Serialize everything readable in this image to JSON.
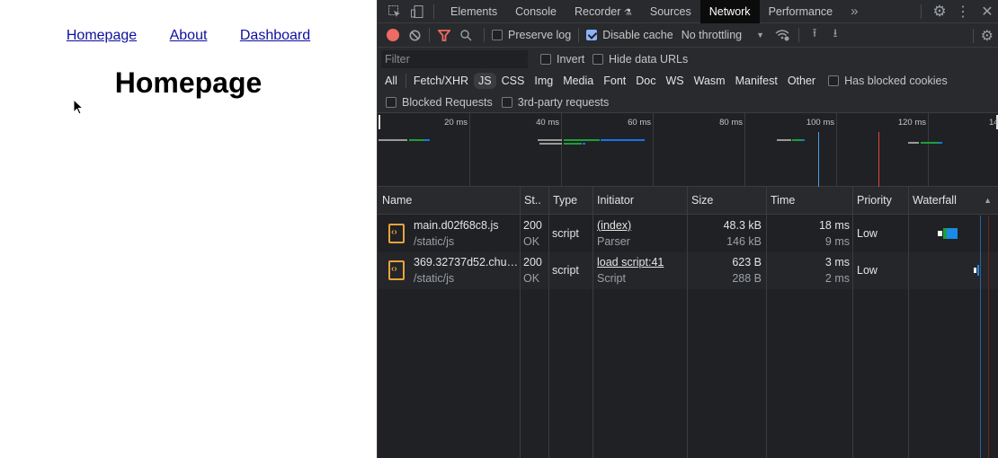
{
  "page": {
    "nav_links": [
      "Homepage",
      "About",
      "Dashboard"
    ],
    "heading": "Homepage"
  },
  "devtools": {
    "tabs": [
      "Elements",
      "Console",
      "Recorder",
      "Sources",
      "Network",
      "Performance"
    ],
    "active_tab": "Network",
    "more_tabs_icon": "»",
    "toolbar": {
      "preserve_log": "Preserve log",
      "preserve_log_checked": false,
      "disable_cache": "Disable cache",
      "disable_cache_checked": true,
      "throttling": "No throttling"
    },
    "filter": {
      "placeholder": "Filter",
      "invert": "Invert",
      "hide_data_urls": "Hide data URLs"
    },
    "types": [
      "All",
      "Fetch/XHR",
      "JS",
      "CSS",
      "Img",
      "Media",
      "Font",
      "Doc",
      "WS",
      "Wasm",
      "Manifest",
      "Other"
    ],
    "active_type": "JS",
    "has_blocked_cookies": "Has blocked cookies",
    "blocked_requests": "Blocked Requests",
    "third_party": "3rd-party requests",
    "overview_ticks": [
      "20 ms",
      "40 ms",
      "60 ms",
      "80 ms",
      "100 ms",
      "120 ms",
      "14"
    ],
    "columns": [
      "Name",
      "St..",
      "Type",
      "Initiator",
      "Size",
      "Time",
      "Priority",
      "Waterfall"
    ],
    "requests": [
      {
        "name": "main.d02f68c8.js",
        "path": "/static/js",
        "status": "200",
        "status_text": "OK",
        "type": "script",
        "initiator": "(index)",
        "initiator_type": "Parser",
        "size": "48.3 kB",
        "resource_size": "146 kB",
        "time": "18 ms",
        "latency": "9 ms",
        "priority": "Low"
      },
      {
        "name": "369.32737d52.chu…",
        "path": "/static/js",
        "status": "200",
        "status_text": "OK",
        "type": "script",
        "initiator": "load script:41",
        "initiator_type": "Script",
        "size": "623 B",
        "resource_size": "288 B",
        "time": "3 ms",
        "latency": "2 ms",
        "priority": "Low"
      }
    ]
  }
}
